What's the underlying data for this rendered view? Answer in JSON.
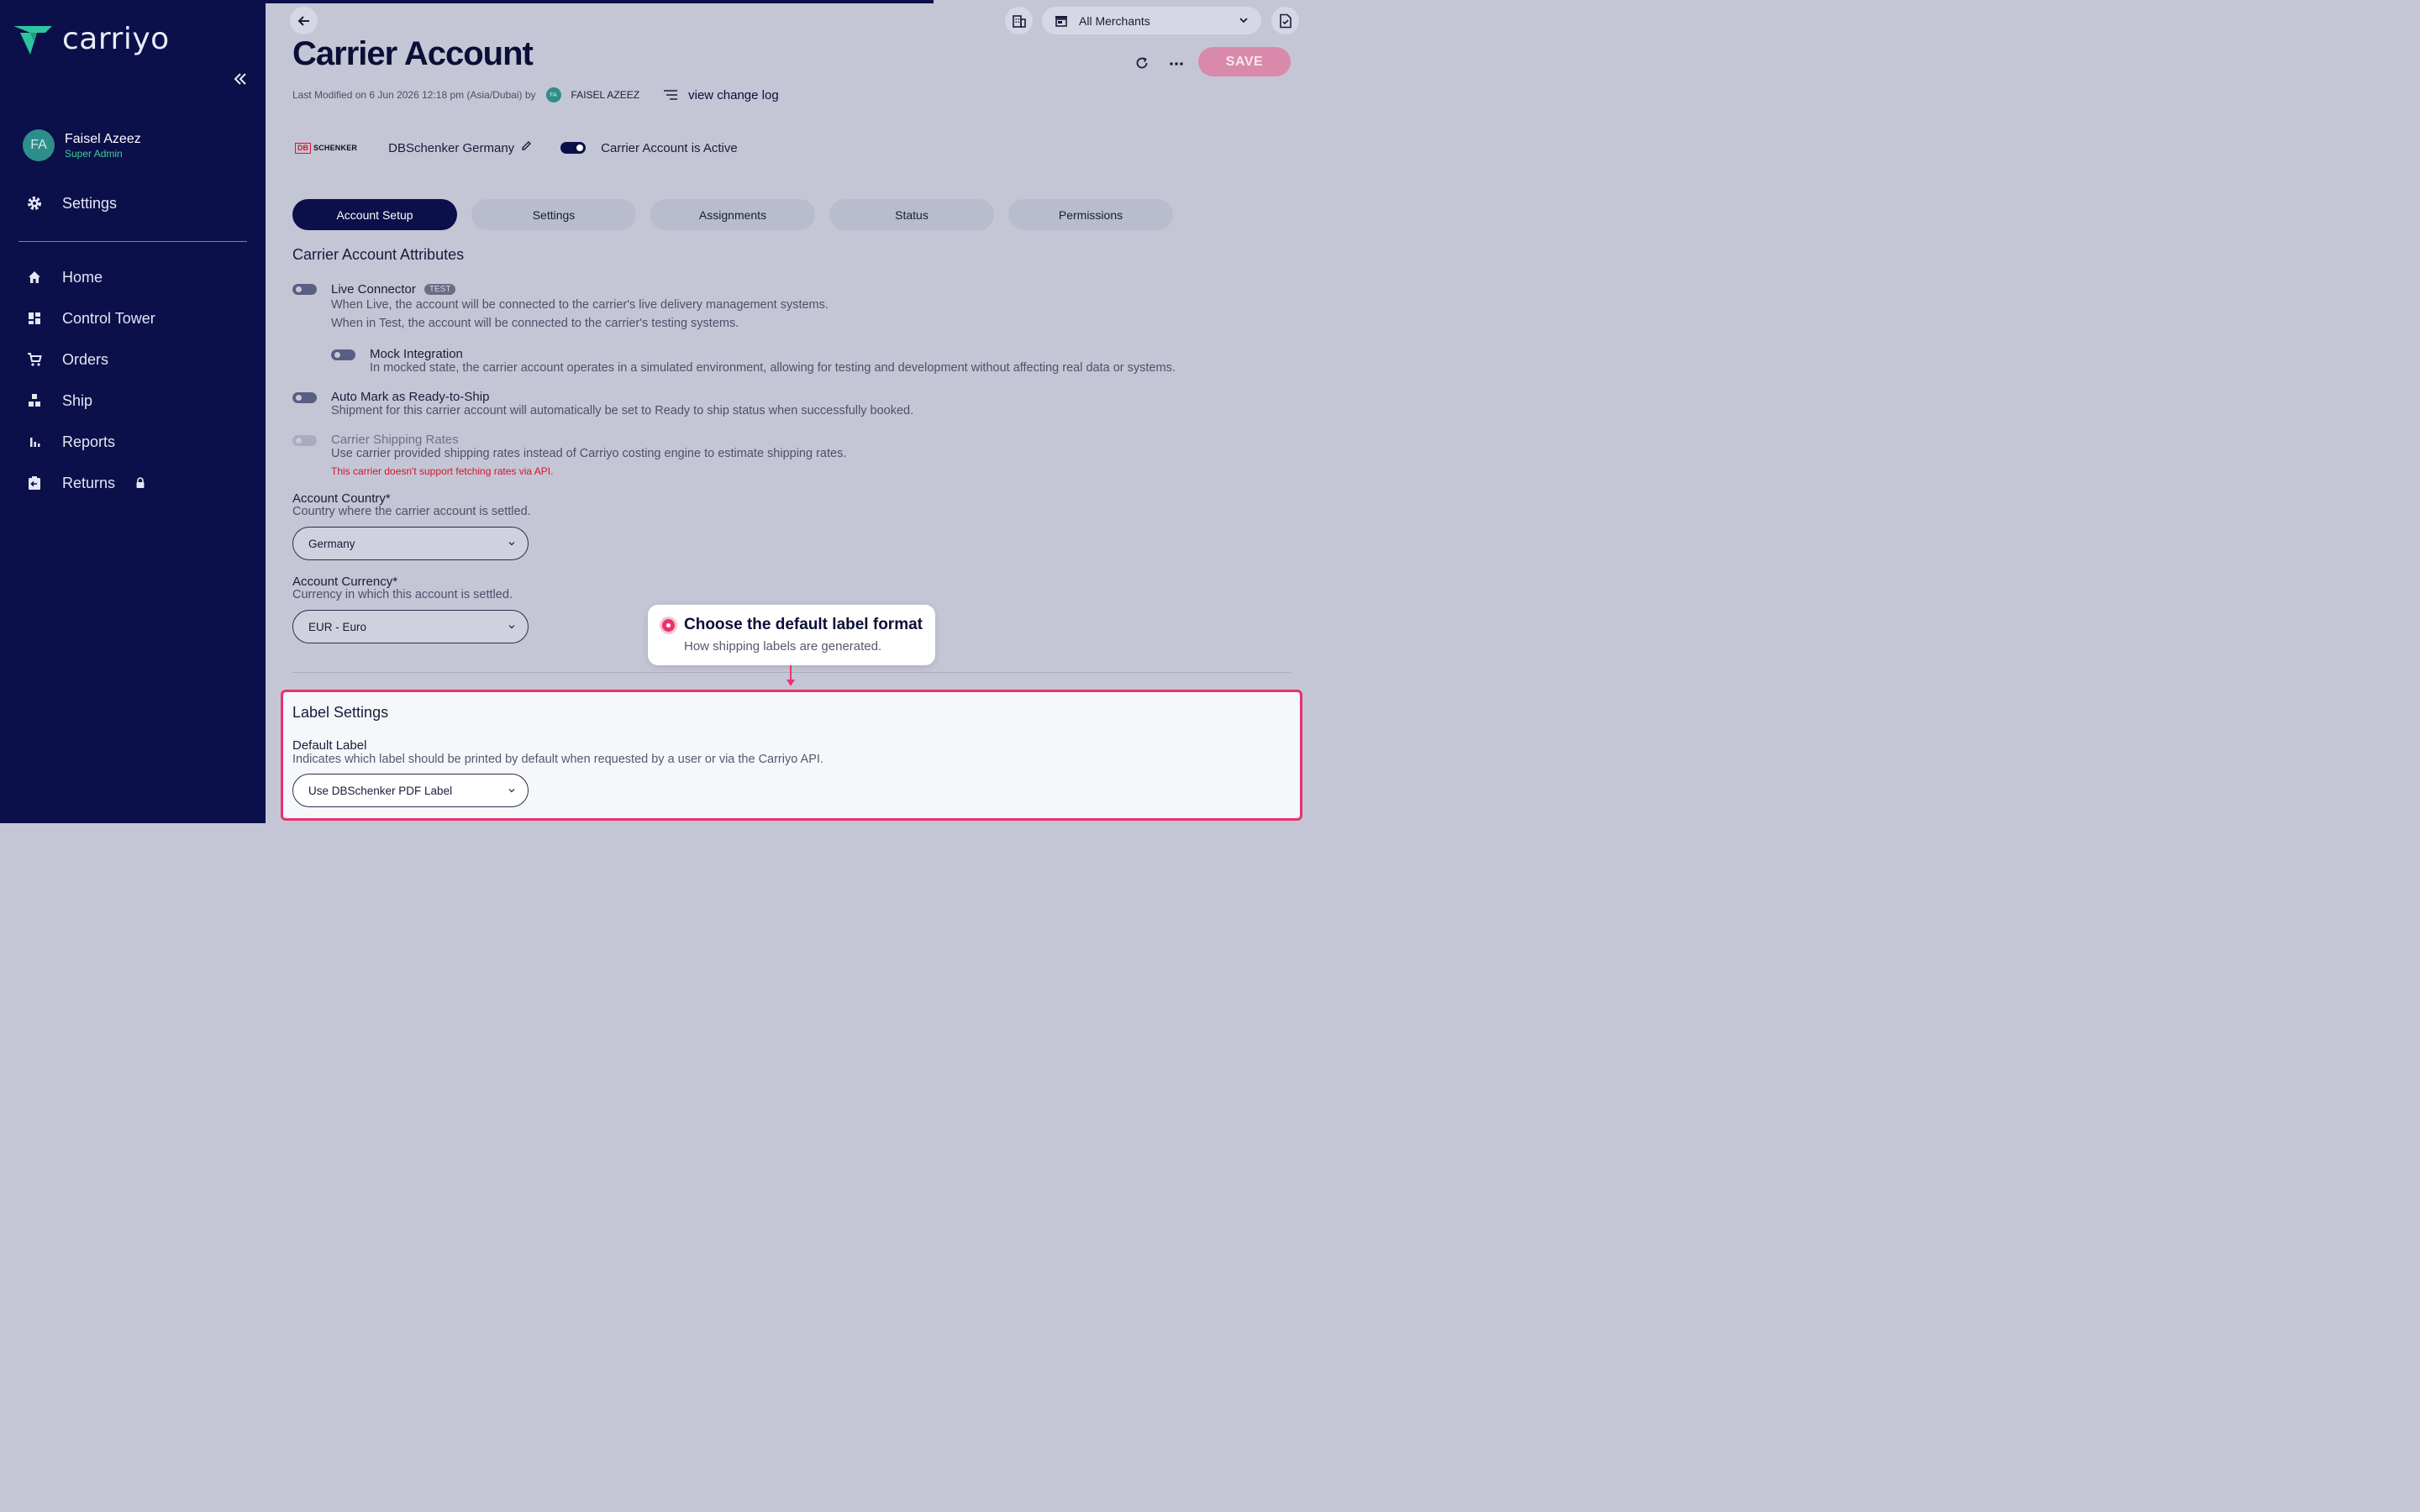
{
  "sidebar": {
    "logo_text": "carriyo",
    "user": {
      "initials": "FA",
      "name": "Faisel Azeez",
      "role": "Super Admin"
    },
    "settings_label": "Settings",
    "items": [
      {
        "label": "Home",
        "icon": "home-icon"
      },
      {
        "label": "Control Tower",
        "icon": "dashboard-icon"
      },
      {
        "label": "Orders",
        "icon": "cart-icon"
      },
      {
        "label": "Ship",
        "icon": "boxes-icon"
      },
      {
        "label": "Reports",
        "icon": "bar-chart-icon"
      },
      {
        "label": "Returns",
        "icon": "returns-icon",
        "locked": true
      }
    ]
  },
  "topbar": {
    "merchant_select": "All Merchants"
  },
  "header": {
    "title": "Carrier Account",
    "meta_prefix": "Last Modified on 6 Jun 2026 12:18 pm (Asia/Dubai) by",
    "modifier_initials": "FA",
    "modifier_name": "FAISEL AZEEZ",
    "change_log_label": "view change log",
    "save_label": "SAVE"
  },
  "carrier": {
    "logo_box": "DB",
    "logo_text": "SCHENKER",
    "name": "DBSchenker Germany",
    "active_label": "Carrier Account is Active",
    "is_active": true
  },
  "tabs": [
    {
      "label": "Account Setup",
      "active": true
    },
    {
      "label": "Settings",
      "active": false
    },
    {
      "label": "Assignments",
      "active": false
    },
    {
      "label": "Status",
      "active": false
    },
    {
      "label": "Permissions",
      "active": false
    }
  ],
  "attributes": {
    "section_title": "Carrier Account Attributes",
    "live_connector": {
      "label": "Live Connector",
      "badge": "TEST",
      "desc1": "When Live, the account will be connected to the carrier's live delivery management systems.",
      "desc2": "When in Test, the account will be connected to the carrier's testing systems."
    },
    "mock_integration": {
      "label": "Mock Integration",
      "desc": "In mocked state, the carrier account operates in a simulated environment, allowing for testing and development without affecting real data or systems."
    },
    "auto_mark": {
      "label": "Auto Mark as Ready-to-Ship",
      "desc": "Shipment for this carrier account will automatically be set to Ready to ship status when successfully booked."
    },
    "shipping_rates": {
      "label": "Carrier Shipping Rates",
      "desc": "Use carrier provided shipping rates instead of Carriyo costing engine to estimate shipping rates.",
      "error": "This carrier doesn't support fetching rates via API."
    },
    "account_country": {
      "label": "Account Country*",
      "help": "Country where the carrier account is settled.",
      "value": "Germany"
    },
    "account_currency": {
      "label": "Account Currency*",
      "help": "Currency in which this account is settled.",
      "value": "EUR - Euro"
    }
  },
  "label_settings": {
    "title": "Label Settings",
    "default_label": {
      "label": "Default Label",
      "help": "Indicates which label should be printed by default when requested by a user or via the Carriyo API.",
      "value": "Use DBSchenker PDF Label"
    }
  },
  "tooltip": {
    "title": "Choose the default label format",
    "subtitle": "How shipping labels are generated."
  },
  "colors": {
    "sidebar_bg": "#0b0f4a",
    "accent_pink": "#e8336e",
    "brand_green": "#2ec4a0"
  }
}
